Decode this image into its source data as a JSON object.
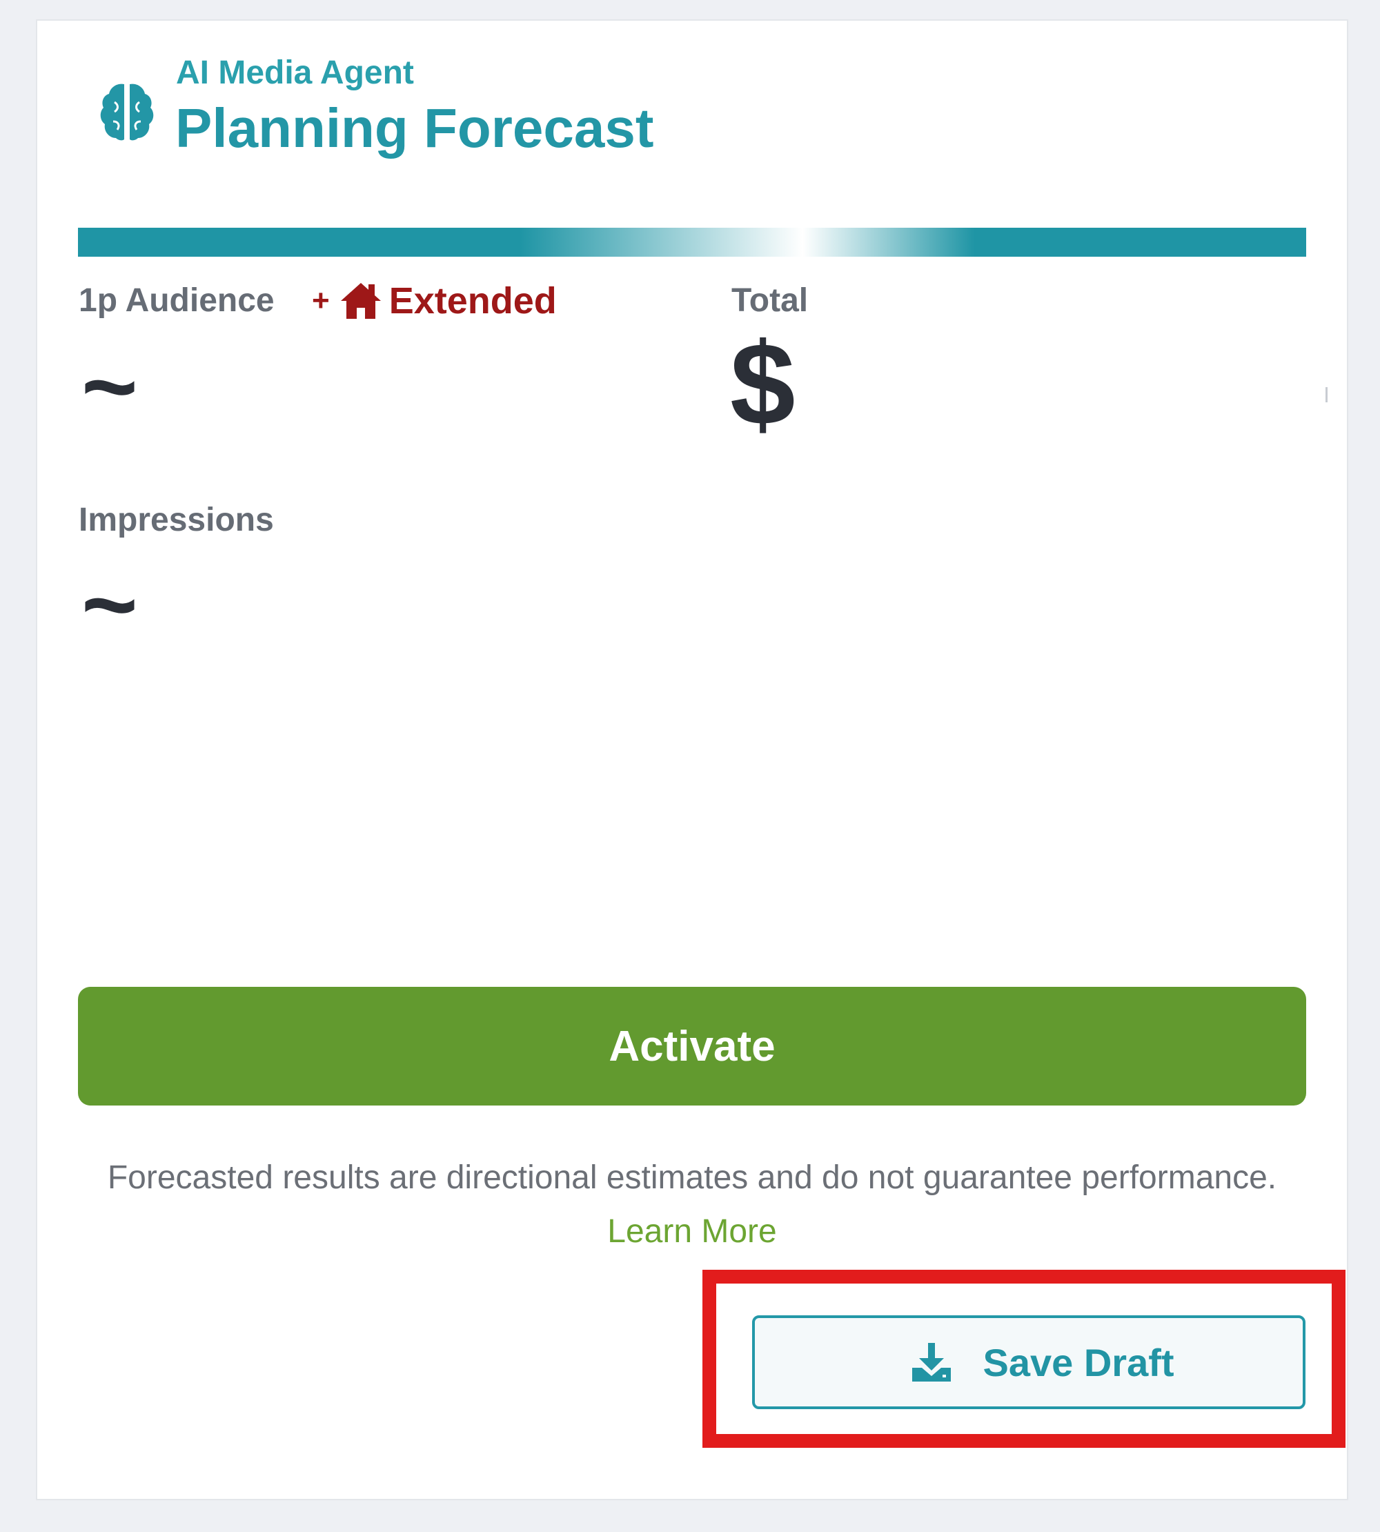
{
  "header": {
    "eyebrow": "AI Media Agent",
    "title": "Planning Forecast",
    "icon": "brain-icon"
  },
  "metrics": {
    "audience": {
      "label": "1p Audience",
      "extended_prefix": "+",
      "extended_icon": "home-icon",
      "extended_label": "Extended",
      "value": "~"
    },
    "total": {
      "label": "Total",
      "value": "$"
    },
    "impressions": {
      "label": "Impressions",
      "value": "~"
    }
  },
  "actions": {
    "activate_label": "Activate",
    "save_draft_label": "Save Draft",
    "save_draft_icon": "download-icon"
  },
  "disclaimer": {
    "text": "Forecasted results are directional estimates and do not guarantee performance. ",
    "link_label": "Learn More"
  },
  "colors": {
    "brand_teal": "#2396a6",
    "extended_red": "#9e1818",
    "activate_green": "#629a2f",
    "link_green": "#6ca532",
    "highlight_red": "#e21c1c"
  }
}
